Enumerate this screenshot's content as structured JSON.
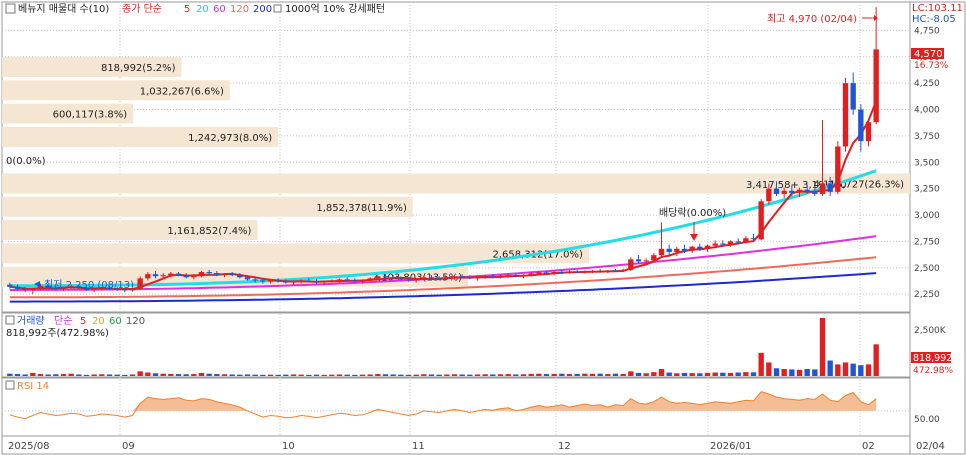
{
  "colors": {
    "up": "#e02020",
    "down": "#1f56d6",
    "ma5": "#e02020",
    "ma20": "#22dde6",
    "ma60": "#e02ee0",
    "ma120": "#f06a5a",
    "ma200": "#1c2ad0",
    "volume_profile": "#f5e6d3",
    "rsi": "#f08030",
    "rsi_fill": "#f4bd93",
    "grid": "#c8c8c8",
    "axis_text": "#444444",
    "price_tag_bg": "#e02020"
  },
  "header": {
    "icon": "square-checkbox-icon",
    "title": "베뉴지 매물대 수(10)",
    "ma_label": "종가 단순",
    "ma_periods": [
      "5",
      "20",
      "60",
      "120",
      "200"
    ],
    "extra": "1000억 10% 강세패턴",
    "lc_label": "LC:103.11",
    "hc_label": "HC:-8.05"
  },
  "price_panel": {
    "high_marker": "최고 4,970 (02/04)",
    "dividend_marker": "배당락(0.00%)",
    "low_marker": "최저 2,250 (08/13)",
    "current_price": "4,570",
    "current_change": "16.73%",
    "y_ticks": [
      "4,750",
      "4,500",
      "4,250",
      "4,000",
      "3,750",
      "3,500",
      "3,250",
      "3,000",
      "2,750",
      "2,500",
      "2,250"
    ]
  },
  "volume_panel": {
    "label": "거래량",
    "ma_label": "단순",
    "ma_periods": [
      "5",
      "20",
      "60",
      "120"
    ],
    "value_line": "818,992주(472.98%)",
    "y_tick": "2,500K",
    "current_value": "818,992",
    "current_pct": "472.98%"
  },
  "rsi_panel": {
    "label": "RSI 14",
    "y_tick": "50.00"
  },
  "x_axis": {
    "labels": [
      "2025/08",
      "09",
      "10",
      "11",
      "12",
      "2026/01",
      "02"
    ],
    "last_date": "02/04"
  },
  "chart_data": [
    {
      "type": "candlestick",
      "title": "베뉴지 매물대 수(10)",
      "x_labels": [
        "2025/08",
        "09",
        "10",
        "11",
        "12",
        "2026/01",
        "02"
      ],
      "y_range": [
        2100,
        5000
      ],
      "high": {
        "value": 4970,
        "date": "02/04"
      },
      "low": {
        "value": 2250,
        "date": "08/13"
      },
      "last_close": 4570,
      "last_change_pct": 16.73,
      "ohlc": [
        [
          2340,
          2360,
          2300,
          2320
        ],
        [
          2320,
          2340,
          2290,
          2300
        ],
        [
          2300,
          2320,
          2270,
          2290
        ],
        [
          2290,
          2310,
          2250,
          2300
        ],
        [
          2300,
          2350,
          2290,
          2330
        ],
        [
          2330,
          2345,
          2300,
          2310
        ],
        [
          2310,
          2330,
          2290,
          2300
        ],
        [
          2300,
          2320,
          2280,
          2310
        ],
        [
          2310,
          2340,
          2300,
          2325
        ],
        [
          2325,
          2335,
          2300,
          2310
        ],
        [
          2310,
          2320,
          2280,
          2290
        ],
        [
          2290,
          2310,
          2270,
          2300
        ],
        [
          2300,
          2320,
          2285,
          2315
        ],
        [
          2315,
          2330,
          2290,
          2300
        ],
        [
          2300,
          2320,
          2280,
          2295
        ],
        [
          2295,
          2310,
          2270,
          2285
        ],
        [
          2285,
          2310,
          2275,
          2300
        ],
        [
          2300,
          2420,
          2290,
          2400
        ],
        [
          2400,
          2460,
          2380,
          2440
        ],
        [
          2440,
          2470,
          2400,
          2420
        ],
        [
          2420,
          2450,
          2390,
          2430
        ],
        [
          2430,
          2460,
          2410,
          2445
        ],
        [
          2445,
          2460,
          2420,
          2430
        ],
        [
          2430,
          2450,
          2400,
          2410
        ],
        [
          2410,
          2440,
          2390,
          2420
        ],
        [
          2420,
          2470,
          2410,
          2460
        ],
        [
          2460,
          2480,
          2430,
          2450
        ],
        [
          2450,
          2470,
          2420,
          2430
        ],
        [
          2430,
          2450,
          2410,
          2440
        ],
        [
          2440,
          2460,
          2420,
          2430
        ],
        [
          2430,
          2450,
          2400,
          2410
        ],
        [
          2410,
          2430,
          2380,
          2390
        ],
        [
          2390,
          2410,
          2360,
          2380
        ],
        [
          2380,
          2400,
          2350,
          2370
        ],
        [
          2370,
          2390,
          2350,
          2380
        ],
        [
          2380,
          2400,
          2360,
          2370
        ],
        [
          2370,
          2390,
          2350,
          2360
        ],
        [
          2360,
          2380,
          2340,
          2370
        ],
        [
          2370,
          2390,
          2350,
          2380
        ],
        [
          2380,
          2400,
          2360,
          2370
        ],
        [
          2370,
          2390,
          2350,
          2360
        ],
        [
          2360,
          2380,
          2340,
          2370
        ],
        [
          2370,
          2390,
          2360,
          2380
        ],
        [
          2380,
          2400,
          2360,
          2390
        ],
        [
          2390,
          2410,
          2370,
          2380
        ],
        [
          2380,
          2400,
          2360,
          2370
        ],
        [
          2370,
          2390,
          2350,
          2380
        ],
        [
          2380,
          2410,
          2370,
          2400
        ],
        [
          2400,
          2430,
          2390,
          2420
        ],
        [
          2420,
          2440,
          2400,
          2410
        ],
        [
          2410,
          2430,
          2390,
          2400
        ],
        [
          2400,
          2420,
          2380,
          2390
        ],
        [
          2390,
          2410,
          2370,
          2380
        ],
        [
          2380,
          2400,
          2360,
          2390
        ],
        [
          2390,
          2420,
          2380,
          2410
        ],
        [
          2410,
          2430,
          2390,
          2400
        ],
        [
          2400,
          2420,
          2380,
          2395
        ],
        [
          2395,
          2420,
          2385,
          2410
        ],
        [
          2410,
          2430,
          2390,
          2420
        ],
        [
          2420,
          2440,
          2400,
          2410
        ],
        [
          2410,
          2430,
          2390,
          2400
        ],
        [
          2400,
          2420,
          2380,
          2410
        ],
        [
          2410,
          2430,
          2395,
          2420
        ],
        [
          2420,
          2440,
          2400,
          2415
        ],
        [
          2415,
          2435,
          2400,
          2425
        ],
        [
          2425,
          2445,
          2405,
          2430
        ],
        [
          2430,
          2450,
          2410,
          2420
        ],
        [
          2420,
          2440,
          2400,
          2430
        ],
        [
          2430,
          2460,
          2420,
          2445
        ],
        [
          2445,
          2470,
          2430,
          2455
        ],
        [
          2455,
          2470,
          2440,
          2450
        ],
        [
          2450,
          2470,
          2430,
          2460
        ],
        [
          2460,
          2480,
          2440,
          2455
        ],
        [
          2455,
          2475,
          2445,
          2465
        ],
        [
          2465,
          2480,
          2450,
          2460
        ],
        [
          2460,
          2475,
          2445,
          2465
        ],
        [
          2465,
          2480,
          2450,
          2470
        ],
        [
          2470,
          2490,
          2455,
          2460
        ],
        [
          2460,
          2480,
          2450,
          2475
        ],
        [
          2475,
          2490,
          2460,
          2470
        ],
        [
          2470,
          2490,
          2460,
          2480
        ],
        [
          2480,
          2600,
          2470,
          2580
        ],
        [
          2580,
          2620,
          2540,
          2560
        ],
        [
          2560,
          2590,
          2530,
          2570
        ],
        [
          2570,
          2640,
          2560,
          2620
        ],
        [
          2620,
          2930,
          2600,
          2680
        ],
        [
          2680,
          2720,
          2620,
          2650
        ],
        [
          2650,
          2700,
          2610,
          2680
        ],
        [
          2680,
          2720,
          2640,
          2660
        ],
        [
          2660,
          2710,
          2640,
          2700
        ],
        [
          2700,
          2730,
          2660,
          2680
        ],
        [
          2680,
          2720,
          2650,
          2710
        ],
        [
          2710,
          2760,
          2690,
          2730
        ],
        [
          2730,
          2760,
          2700,
          2720
        ],
        [
          2720,
          2760,
          2700,
          2750
        ],
        [
          2750,
          2780,
          2720,
          2740
        ],
        [
          2740,
          2800,
          2730,
          2780
        ],
        [
          2780,
          2820,
          2750,
          2770
        ],
        [
          2770,
          3150,
          2760,
          3130
        ],
        [
          3130,
          3300,
          3100,
          3250
        ],
        [
          3250,
          3320,
          3180,
          3200
        ],
        [
          3200,
          3260,
          3160,
          3230
        ],
        [
          3230,
          3280,
          3180,
          3210
        ],
        [
          3210,
          3260,
          3170,
          3240
        ],
        [
          3240,
          3290,
          3200,
          3220
        ],
        [
          3220,
          3270,
          3180,
          3200
        ],
        [
          3200,
          3900,
          3180,
          3300
        ],
        [
          3300,
          3360,
          3180,
          3220
        ],
        [
          3220,
          3700,
          3200,
          3650
        ],
        [
          3650,
          4300,
          3600,
          4250
        ],
        [
          4250,
          4350,
          3950,
          4000
        ],
        [
          4000,
          4050,
          3600,
          3700
        ],
        [
          3700,
          3900,
          3650,
          3880
        ],
        [
          3880,
          4970,
          3860,
          4570
        ]
      ],
      "moving_averages": [
        {
          "name": "5",
          "start": 2310,
          "end": 3950
        },
        {
          "name": "20",
          "start": 2330,
          "end": 3420
        },
        {
          "name": "60",
          "start": 2290,
          "end": 2800
        },
        {
          "name": "120",
          "start": 2220,
          "end": 2600
        },
        {
          "name": "200",
          "start": 2180,
          "end": 2450
        }
      ],
      "volume_profile": [
        {
          "label": "818,992(5.2%)",
          "pct": 5.2
        },
        {
          "label": "1,032,267(6.6%)",
          "pct": 6.6
        },
        {
          "label": "600,117(3.8%)",
          "pct": 3.8
        },
        {
          "label": "1,242,973(8.0%)",
          "pct": 8.0
        },
        {
          "label": "0(0.0%)",
          "pct": 0.0
        },
        {
          "label": "4,115,727(26.3%)",
          "pct": 26.3
        },
        {
          "label": "1,852,378(11.9%)",
          "pct": 11.9
        },
        {
          "label": "1,161,852(7.4%)",
          "pct": 7.4
        },
        {
          "label": "2,658,312(17.0%)",
          "pct": 17.0
        },
        {
          "label": "2,103,803(13.5%)",
          "pct": 13.5
        }
      ],
      "volume_profile_extra_label": "3,417,58+ 3,19,200",
      "y_ticks": [
        4750,
        4500,
        4250,
        4000,
        3750,
        3500,
        3250,
        3000,
        2750,
        2500,
        2250
      ]
    },
    {
      "type": "bar",
      "title": "거래량",
      "y_tick": "2,500K",
      "last_value": 818992,
      "last_pct": 472.98,
      "values": [
        60,
        50,
        40,
        80,
        50,
        40,
        45,
        50,
        60,
        40,
        30,
        40,
        45,
        40,
        35,
        30,
        40,
        120,
        90,
        70,
        60,
        55,
        50,
        45,
        50,
        80,
        60,
        50,
        45,
        40,
        35,
        40,
        35,
        30,
        35,
        30,
        35,
        40,
        35,
        30,
        35,
        30,
        35,
        40,
        35,
        30,
        35,
        40,
        50,
        45,
        40,
        35,
        30,
        35,
        45,
        40,
        35,
        40,
        45,
        40,
        35,
        40,
        45,
        40,
        45,
        50,
        40,
        45,
        55,
        60,
        50,
        55,
        60,
        50,
        55,
        60,
        55,
        60,
        50,
        60,
        55,
        120,
        80,
        70,
        100,
        180,
        90,
        70,
        80,
        75,
        70,
        80,
        90,
        85,
        80,
        90,
        100,
        95,
        600,
        350,
        200,
        180,
        170,
        160,
        180,
        170,
        1500,
        400,
        300,
        350,
        320,
        280,
        300,
        819
      ]
    },
    {
      "type": "line",
      "title": "RSI 14",
      "y_tick": 50,
      "values": [
        45,
        42,
        40,
        44,
        48,
        46,
        44,
        45,
        47,
        46,
        43,
        44,
        46,
        45,
        44,
        42,
        44,
        60,
        68,
        66,
        65,
        66,
        67,
        64,
        63,
        66,
        65,
        62,
        60,
        58,
        55,
        50,
        46,
        42,
        44,
        43,
        41,
        42,
        44,
        43,
        41,
        43,
        45,
        47,
        46,
        44,
        45,
        48,
        52,
        50,
        48,
        46,
        44,
        46,
        50,
        49,
        48,
        50,
        52,
        50,
        48,
        50,
        52,
        51,
        53,
        54,
        50,
        52,
        55,
        57,
        55,
        56,
        58,
        55,
        57,
        59,
        57,
        58,
        55,
        58,
        57,
        66,
        60,
        59,
        62,
        68,
        62,
        60,
        61,
        60,
        58,
        60,
        62,
        61,
        60,
        62,
        64,
        63,
        75,
        72,
        68,
        66,
        65,
        64,
        66,
        65,
        72,
        64,
        62,
        70,
        74,
        62,
        58,
        66
      ]
    }
  ]
}
